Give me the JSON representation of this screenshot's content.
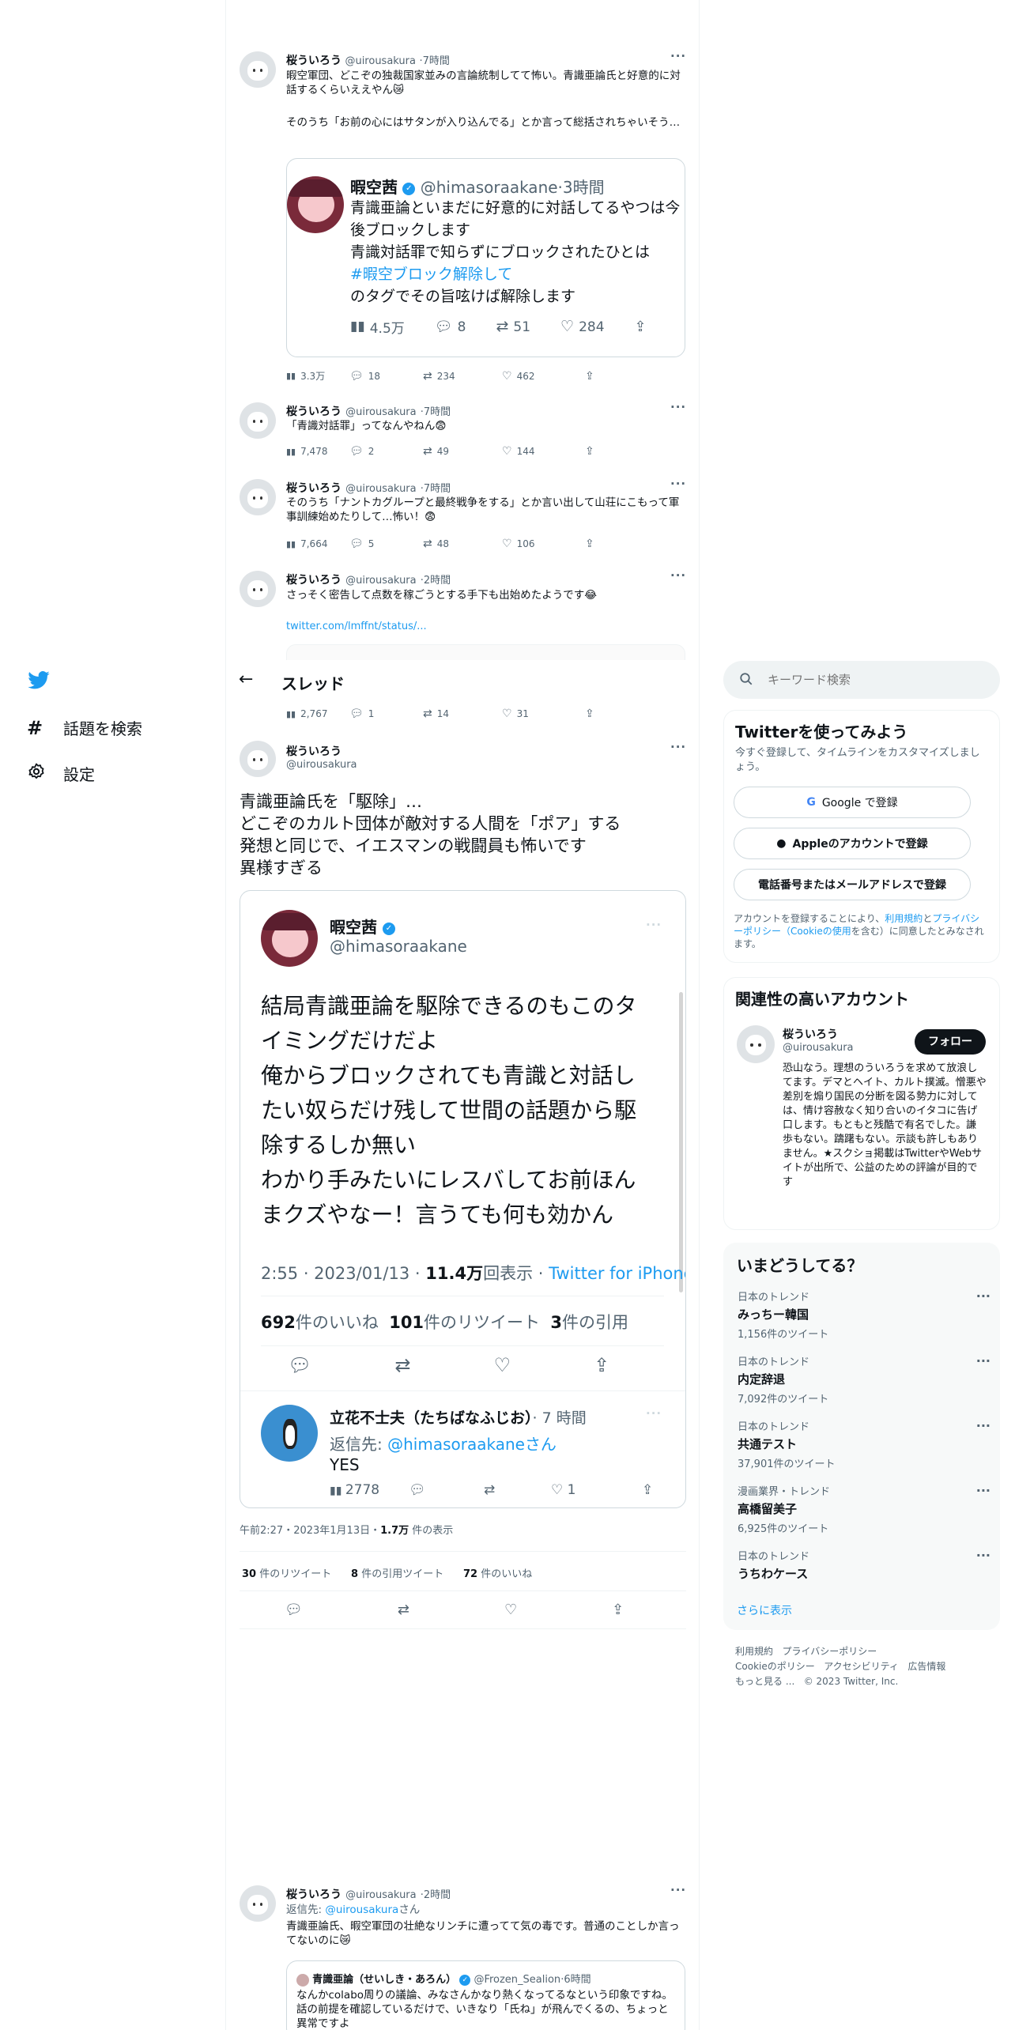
{
  "nav": {
    "explore_label": "話題を検索",
    "settings_label": "設定"
  },
  "header": {
    "title": "スレッド"
  },
  "search": {
    "placeholder": "キーワード検索"
  },
  "t1": {
    "name": "桜ういろう",
    "handle": "@uirousakura",
    "time": "7時間",
    "text1": "暇空軍団、どこぞの独裁国家並みの言論統制してて怖い。青識亜論氏と好意的に対話するくらいええやん😿",
    "text2": "そのうち「お前の心にはサタンが入り込んでる」とか言って総括されちゃいそう…",
    "quote": {
      "name": "暇空茜",
      "handle": "@himasoraakane",
      "time": "3時間",
      "line1": "青識亜論といまだに好意的に対話してるやつは今後ブロックします",
      "line2": "青識対話罪で知らずにブロックされたひとは",
      "tag": "#暇空ブロック解除して",
      "line3": "のタグでその旨呟けば解除します",
      "views": "4.5万",
      "replies": "8",
      "rts": "51",
      "likes": "284"
    },
    "views": "3.3万",
    "replies": "18",
    "rts": "234",
    "likes": "462"
  },
  "t2": {
    "name": "桜ういろう",
    "handle": "@uirousakura",
    "time": "7時間",
    "text": "「青識対話罪」ってなんやねん😨",
    "views": "7,478",
    "replies": "2",
    "rts": "49",
    "likes": "144"
  },
  "t3": {
    "name": "桜ういろう",
    "handle": "@uirousakura",
    "time": "7時間",
    "text": "そのうち「ナントカグループと最終戦争をする」とか言い出して山荘にこもって軍事訓練始めたりして…怖い！😨",
    "views": "7,664",
    "replies": "5",
    "rts": "48",
    "likes": "106"
  },
  "t4": {
    "name": "桜ういろう",
    "handle": "@uirousakura",
    "time": "2時間",
    "text": "さっそく密告して点数を稼ごうとする手下も出始めたようです😂",
    "link": "twitter.com/lmffnt/status/...",
    "views": "2,767",
    "replies": "1",
    "rts": "14",
    "likes": "31"
  },
  "main": {
    "name": "桜ういろう",
    "handle": "@uirousakura",
    "text1": "青識亜論氏を「駆除」…",
    "text2": "どこぞのカルト団体が敵対する人間を「ポア」する",
    "text3": "発想と同じで、イエスマンの戦闘員も怖いです",
    "text4": "異様すぎる",
    "embed": {
      "name": "暇空茜",
      "handle": "@himasoraakane",
      "l1": "結局青識亜論を駆除できるのもこのタ",
      "l2": "イミングだけだよ",
      "l3": "俺からブロックされても青識と対話し",
      "l4": "たい奴らだけ残して世間の話題から駆",
      "l5": "除するしか無い",
      "l6": "わかり手みたいにレスバしてお前ほん",
      "l7": "まクズやなー！言うても何も効かん",
      "time": "2:55 · 2023/01/13 · ",
      "views": "11.4万",
      "views_suffix": "回表示 · ",
      "source": "Twitter for iPhone",
      "likes": "692",
      "likes_label": "件のいいね",
      "rts": "101",
      "rts_label": "件のリツイート",
      "quotes": "3",
      "quotes_label": "件の引用",
      "reply": {
        "name": "立花不士夫（たちばなふじお）",
        "time": "· 7 時間",
        "to_label": "返信先: ",
        "to": "@himasoraakane",
        "to_suffix": "さん",
        "text": "YES",
        "views": "2778",
        "likes": "1"
      }
    },
    "timestamp": "午前2:27・2023年1月13日・",
    "views": "1.7万",
    "views_label": " 件の表示",
    "rts": "30",
    "rts_label": " 件のリツイート",
    "quotes": "8",
    "quotes_label": " 件の引用ツイート",
    "likes": "72",
    "likes_label": " 件のいいね"
  },
  "t5": {
    "name": "桜ういろう",
    "handle": "@uirousakura",
    "time": "2時間",
    "reply_label": "返信先: ",
    "reply_to": "@uirousakura",
    "reply_suffix": "さん",
    "text": "青識亜論氏、暇空軍団の壮絶なリンチに遭ってて気の毒です。普通のことしか言ってないのに😿",
    "quote": {
      "name": "青識亜論（せいしき・あろん）",
      "handle": "@Frozen_Sealion",
      "time": "6時間",
      "text": "なんかcolabo周りの議論、みなさんかなり熱くなってるなという印象ですね。話の前提を確認しているだけで、いきなり「氏ね」が飛んでくるの、ちょっと異常ですよ"
    }
  },
  "sidebar": {
    "signup_title": "Twitterを使ってみよう",
    "signup_sub": "今すぐ登録して、タイムラインをカスタマイズしましょう。",
    "google_btn": "Google で登録",
    "apple_btn": "Appleのアカウントで登録",
    "phone_btn": "電話番号またはメールアドレスで登録",
    "terms_pre": "アカウントを登録することにより、",
    "terms_link1": "利用規約",
    "terms_mid": "と",
    "terms_link2": "プライバシーポリシー（Cookieの使用",
    "terms_post": "を含む）に同意したとみなされます。",
    "rel_title": "関連性の高いアカウント",
    "rel_name": "桜ういろう",
    "rel_handle": "@uirousakura",
    "follow_btn": "フォロー",
    "rel_bio": "恐山なう。理想のういろうを求めて放浪してます。デマとヘイト、カルト撲滅。憎悪や差別を煽り国民の分断を図る勢力に対しては、情け容赦なく知り合いのイタコに告げ口します。もともと残酷で有名でした。謙歩もない。躊躇もない。示談も許しもありません。★スクショ掲載はTwitterやWebサイトが出所で、公益のための評論が目的です",
    "trends_title": "いまどうしてる？",
    "trends": [
      {
        "cat": "日本のトレンド",
        "title": "みっちー韓国",
        "count": "1,156件のツイート"
      },
      {
        "cat": "日本のトレンド",
        "title": "内定辞退",
        "count": "7,092件のツイート"
      },
      {
        "cat": "日本のトレンド",
        "title": "共通テスト",
        "count": "37,901件のツイート"
      },
      {
        "cat": "漫画業界・トレンド",
        "title": "高橋留美子",
        "count": "6,925件のツイート"
      },
      {
        "cat": "日本のトレンド",
        "title": "うちわケース",
        "count": ""
      }
    ],
    "show_more": "さらに表示",
    "footer1": "利用規約",
    "footer2": "プライバシーポリシー",
    "footer3": "Cookieのポリシー",
    "footer4": "アクセシビリティ",
    "footer5": "広告情報",
    "footer6": "もっと見る ...",
    "footer7": "© 2023 Twitter, Inc."
  },
  "colors": {
    "accent": "#1d9bf0",
    "text": "#0f1419",
    "muted": "#536471",
    "border": "#eff3f4"
  }
}
